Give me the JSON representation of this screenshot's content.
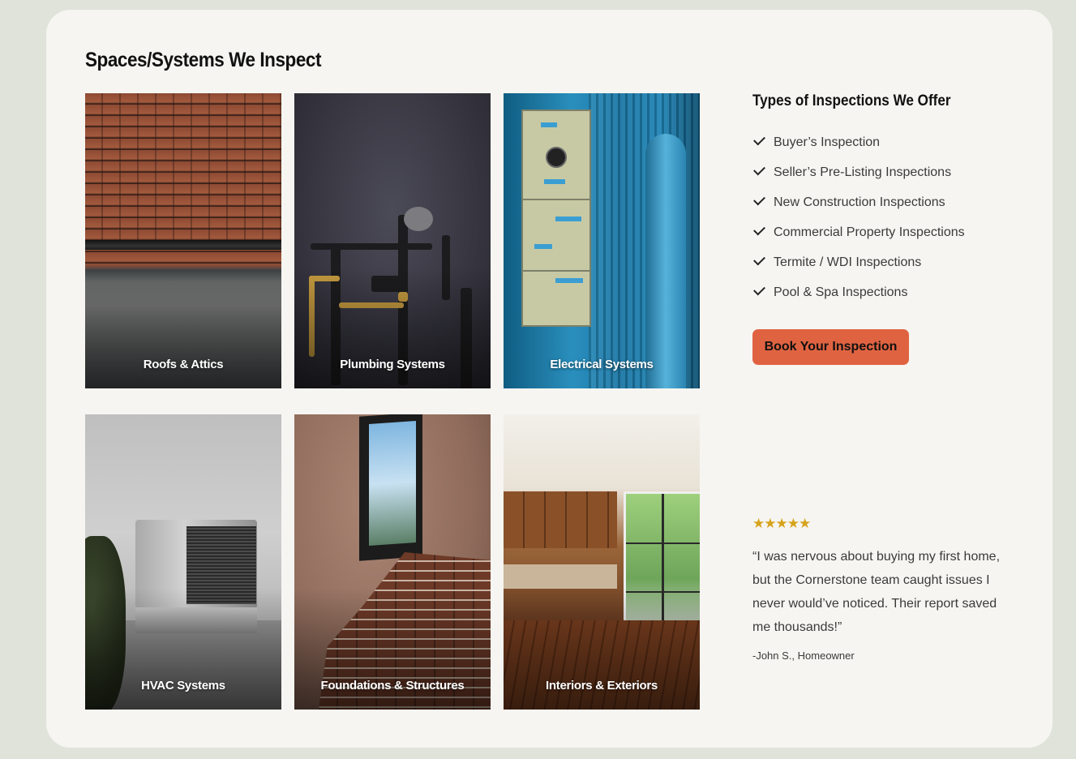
{
  "section": {
    "title": "Spaces/Systems We Inspect"
  },
  "tiles": [
    {
      "label": "Roofs & Attics"
    },
    {
      "label": "Plumbing Systems"
    },
    {
      "label": "Electrical Systems"
    },
    {
      "label": "HVAC Systems"
    },
    {
      "label": "Foundations & Structures"
    },
    {
      "label": "Interiors & Exteriors"
    }
  ],
  "offers": {
    "title": "Types of Inspections We Offer",
    "items": [
      "Buyer’s Inspection",
      "Seller’s Pre-Listing Inspections",
      "New Construction Inspections",
      "Commercial Property Inspections",
      "Termite / WDI Inspections",
      "Pool & Spa Inspections"
    ],
    "cta_label": "Book Your Inspection"
  },
  "testimonial": {
    "rating": 5,
    "stars": "★★★★★",
    "quote": "“I was nervous about buying my first home, but the Cornerstone team caught issues I never would’ve noticed. Their report saved me thousands!”",
    "author": "-John S., Homeowner"
  },
  "colors": {
    "page_bg": "#dfe3da",
    "card_bg": "#f6f5f1",
    "accent": "#e06341",
    "star": "#d6a31c"
  }
}
